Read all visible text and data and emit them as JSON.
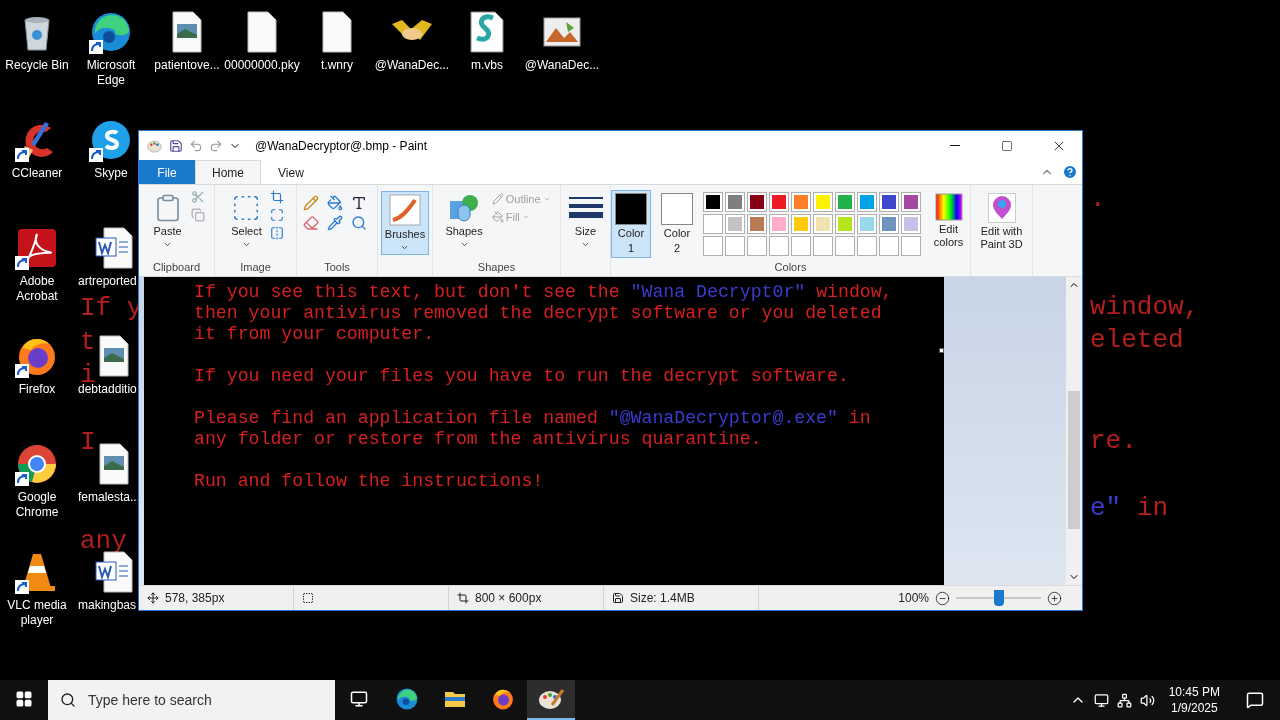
{
  "wallpaper": {
    "left_lines": [
      {
        "segments": [
          {
            "text": "If y",
            "color": "#b51e1e"
          }
        ]
      },
      {
        "segments": [
          {
            "text": "t",
            "color": "#b51e1e"
          }
        ]
      },
      {
        "segments": [
          {
            "text": "i",
            "color": "#b51e1e"
          }
        ]
      },
      {
        "segments": [
          {
            "text": "I",
            "color": "#b51e1e"
          }
        ]
      },
      {
        "segments": [
          {
            "text": "any",
            "color": "#b51e1e"
          }
        ]
      }
    ],
    "right_lines": [
      {
        "segments": [
          {
            "text": ".",
            "color": "#b51e1e"
          }
        ]
      },
      {
        "segments": [
          {
            "text": "window,",
            "color": "#b51e1e"
          }
        ]
      },
      {
        "segments": [
          {
            "text": "eleted",
            "color": "#b51e1e"
          }
        ]
      },
      {
        "segments": [
          {
            "text": "re.",
            "color": "#b51e1e"
          }
        ]
      },
      {
        "segments": [
          {
            "text": "e\"",
            "color": "#3a3acb"
          },
          {
            "text": " in",
            "color": "#b51e1e"
          }
        ]
      }
    ]
  },
  "desktop_icons": [
    {
      "label": "Recycle Bin",
      "kind": "recycle",
      "shortcut": false
    },
    {
      "label": "Microsoft Edge",
      "kind": "edge",
      "shortcut": true
    },
    {
      "label": "patientove...",
      "kind": "image",
      "shortcut": false
    },
    {
      "label": "00000000.pky",
      "kind": "file",
      "shortcut": false
    },
    {
      "label": "t.wnry",
      "kind": "file",
      "shortcut": false
    },
    {
      "label": "@WanaDec...",
      "kind": "handshake",
      "shortcut": false
    },
    {
      "label": "m.vbs",
      "kind": "script",
      "shortcut": false
    },
    {
      "label": "@WanaDec...",
      "kind": "bitmap",
      "shortcut": false
    },
    {
      "label": "CCleaner",
      "kind": "ccleaner",
      "shortcut": true
    },
    {
      "label": "Skype",
      "kind": "skype",
      "shortcut": true
    },
    {
      "label": "Adobe Acrobat",
      "kind": "acrobat",
      "shortcut": true
    },
    {
      "label": "artreported",
      "kind": "word",
      "shortcut": false
    },
    {
      "label": "Firefox",
      "kind": "firefox",
      "shortcut": true
    },
    {
      "label": "debtadditio",
      "kind": "image",
      "shortcut": false
    },
    {
      "label": "Google Chrome",
      "kind": "chrome",
      "shortcut": true
    },
    {
      "label": "femalesta...",
      "kind": "image",
      "shortcut": false
    },
    {
      "label": "VLC media player",
      "kind": "vlc",
      "shortcut": true
    },
    {
      "label": "makingbas",
      "kind": "word",
      "shortcut": false
    }
  ],
  "window": {
    "title": "@WanaDecryptor@.bmp - Paint"
  },
  "tabs": [
    {
      "label": "File",
      "kind": "file",
      "selected": false
    },
    {
      "label": "Home",
      "kind": "tab",
      "selected": true
    },
    {
      "label": "View",
      "kind": "tab",
      "selected": false
    }
  ],
  "ribbon": {
    "clipboard": {
      "label": "Clipboard",
      "paste": "Paste"
    },
    "image": {
      "label": "Image",
      "select": "Select"
    },
    "tools": {
      "label": "Tools"
    },
    "brushes": {
      "label": "Brushes",
      "selected": true
    },
    "shapes": {
      "label": "Shapes",
      "shapes": "Shapes",
      "outline": {
        "label": "Outline",
        "disabled": true
      },
      "fill": {
        "label": "Fill",
        "disabled": true
      }
    },
    "size": {
      "label": "Size"
    },
    "colors": {
      "label": "Colors",
      "slots": [
        {
          "label": "Color",
          "number": "1",
          "selected": true,
          "color": "#000000"
        },
        {
          "label": "Color",
          "number": "2",
          "selected": false,
          "color": "#ffffff"
        }
      ],
      "palette": [
        {
          "color": "#000000"
        },
        {
          "color": "#7f7f7f"
        },
        {
          "color": "#880015"
        },
        {
          "color": "#ed1c24"
        },
        {
          "color": "#ff7f27"
        },
        {
          "color": "#fff200"
        },
        {
          "color": "#22b14c"
        },
        {
          "color": "#00a2e8"
        },
        {
          "color": "#3f48cc"
        },
        {
          "color": "#a349a4"
        },
        {
          "color": "#ffffff"
        },
        {
          "color": "#c3c3c3"
        },
        {
          "color": "#b97a57"
        },
        {
          "color": "#ffaec9"
        },
        {
          "color": "#ffc90e"
        },
        {
          "color": "#efe4b0"
        },
        {
          "color": "#b5e61d"
        },
        {
          "color": "#99d9ea"
        },
        {
          "color": "#7092be"
        },
        {
          "color": "#c8bfe7"
        }
      ],
      "edit_colors": "Edit colors"
    },
    "paint3d": "Edit with Paint 3D"
  },
  "canvas": {
    "paragraphs": [
      {
        "lines": [
          {
            "segments": [
              {
                "text": "If you see this text, but don't see the ",
                "color": "#d42020"
              },
              {
                "text": "\"Wana Decrypt0r\"",
                "color": "#3b3bd0"
              },
              {
                "text": " window,",
                "color": "#d42020"
              }
            ]
          },
          {
            "segments": [
              {
                "text": "then your antivirus removed the decrypt software or you deleted",
                "color": "#d42020"
              }
            ]
          },
          {
            "segments": [
              {
                "text": "it from your computer.",
                "color": "#d42020"
              }
            ]
          }
        ]
      },
      {
        "lines": [
          {
            "segments": [
              {
                "text": "If you need your files you have to run the decrypt software.",
                "color": "#d42020"
              }
            ]
          }
        ]
      },
      {
        "lines": [
          {
            "segments": [
              {
                "text": "Please find an application file named ",
                "color": "#d42020"
              },
              {
                "text": "\"@WanaDecryptor@.exe\"",
                "color": "#3b3bd0"
              },
              {
                "text": " in",
                "color": "#d42020"
              }
            ]
          },
          {
            "segments": [
              {
                "text": "any folder or restore from the antivirus quarantine.",
                "color": "#d42020"
              }
            ]
          }
        ]
      },
      {
        "lines": [
          {
            "segments": [
              {
                "text": "Run and follow the instructions!",
                "color": "#d42020"
              }
            ]
          }
        ]
      }
    ]
  },
  "status_bar": {
    "position": "578, 385px",
    "dimensions": "800 × 600px",
    "size": "Size: 1.4MB",
    "zoom": "100%",
    "zoom_slider": {
      "level": 0.51
    }
  },
  "taskbar": {
    "search": {
      "placeholder": "Type here to search"
    },
    "apps": [
      {
        "kind": "edge",
        "active": false
      },
      {
        "kind": "folder",
        "active": false
      },
      {
        "kind": "firefox",
        "active": false
      },
      {
        "kind": "paint",
        "active": true
      }
    ],
    "time": "10:45 PM",
    "date": "1/9/2025"
  }
}
